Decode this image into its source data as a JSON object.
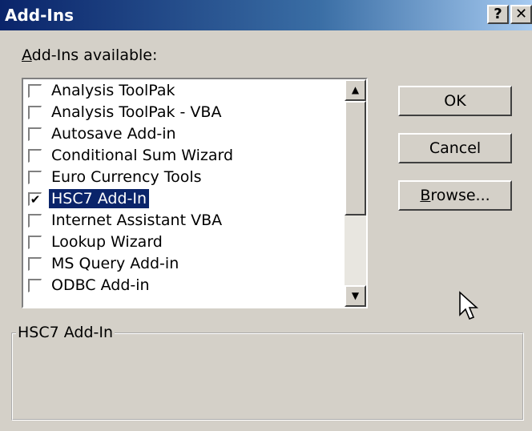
{
  "window": {
    "title": "Add-Ins",
    "help_label": "?",
    "close_label": "✕"
  },
  "list": {
    "label_accel": "A",
    "label_rest": "dd-Ins available:",
    "items": [
      {
        "label": "Analysis ToolPak",
        "checked": false
      },
      {
        "label": "Analysis ToolPak - VBA",
        "checked": false
      },
      {
        "label": "Autosave Add-in",
        "checked": false
      },
      {
        "label": "Conditional Sum Wizard",
        "checked": false
      },
      {
        "label": "Euro Currency Tools",
        "checked": false
      },
      {
        "label": "HSC7 Add-In",
        "checked": true,
        "selected": true
      },
      {
        "label": "Internet Assistant VBA",
        "checked": false
      },
      {
        "label": "Lookup Wizard",
        "checked": false
      },
      {
        "label": "MS Query Add-in",
        "checked": false
      },
      {
        "label": "ODBC Add-in",
        "checked": false
      }
    ],
    "check_glyph": "✔",
    "scroll_up_glyph": "▲",
    "scroll_down_glyph": "▼"
  },
  "buttons": {
    "ok": "OK",
    "cancel": "Cancel",
    "browse_accel": "B",
    "browse_rest": "rowse..."
  },
  "description": {
    "title": "HSC7 Add-In"
  },
  "colors": {
    "title_bar": "#0a246a",
    "selection": "#0a246a",
    "face": "#d4d0c8"
  }
}
